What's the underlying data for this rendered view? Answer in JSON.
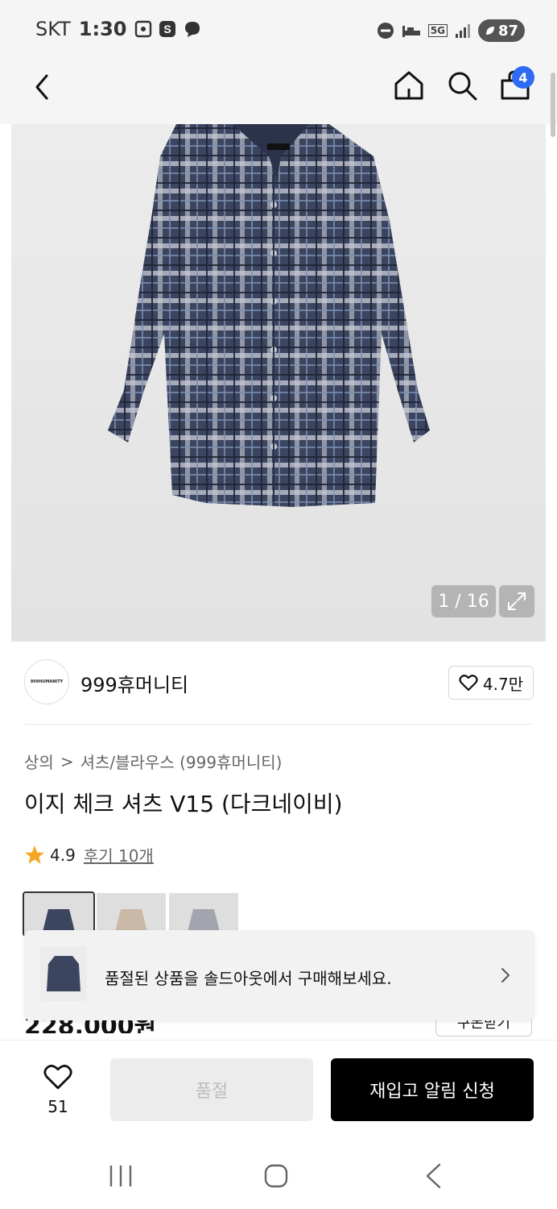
{
  "status_bar": {
    "carrier": "SKT",
    "time": "1:30",
    "network": "5G",
    "battery": "87"
  },
  "header": {
    "cart_count": "4"
  },
  "gallery": {
    "page_indicator": "1 / 16"
  },
  "brand": {
    "logo_text": "999HUMANITY",
    "name": "999휴머니티",
    "likes": "4.7만"
  },
  "product": {
    "breadcrumb": {
      "category": "상의",
      "separator": ">",
      "subcategory": "셔츠/블라우스 (999휴머니티)"
    },
    "title": "이지 체크 셔츠 V15 (다크네이비)",
    "rating": "4.9",
    "reviews": "후기 10개",
    "price": "228,000원",
    "coupon_label": "쿠폰받기"
  },
  "toast": {
    "message": "품절된 상품을 솔드아웃에서 구매해보세요."
  },
  "bottom_bar": {
    "wish_count": "51",
    "soldout_label": "품절",
    "restock_label": "재입고 알림 신청"
  },
  "colors": {
    "accent_badge": "#2f6bf2",
    "star": "#f5a623",
    "primary_button": "#000000",
    "disabled_button": "#ececec"
  }
}
